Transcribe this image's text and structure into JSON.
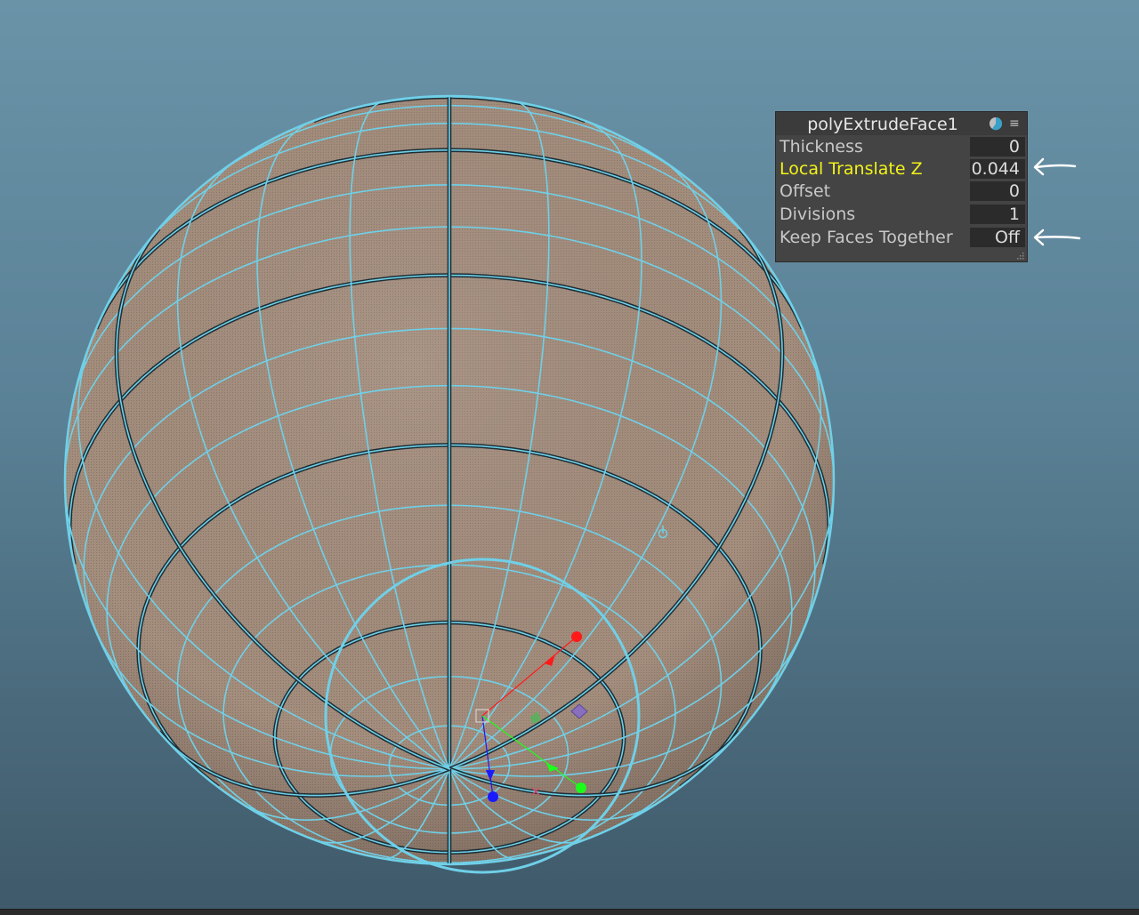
{
  "channel_box": {
    "title": "polyExtrudeFace1",
    "attributes": [
      {
        "label": "Thickness",
        "value": "0"
      },
      {
        "label": "Local Translate Z",
        "value": "0.044"
      },
      {
        "label": "Offset",
        "value": "0"
      },
      {
        "label": "Divisions",
        "value": "1"
      },
      {
        "label": "Keep Faces Together",
        "value": "Off"
      }
    ],
    "highlighted_attribute": "Local Translate Z",
    "highlight_color": "#f2f21a"
  },
  "icons": {
    "panel_icon": "pie-chart-icon",
    "panel_menu": "hamburger-menu-icon",
    "resize": "resize-grip-icon",
    "annotation": "arrow-left-icon",
    "pivot": "pivot-icon"
  },
  "colors": {
    "wireframe": "#6fd0e8",
    "surface": "#a08a7a",
    "background_top": "#6a93a8",
    "background_bottom": "#3f5a6a",
    "gizmo_x": "#ff1a1a",
    "gizmo_y": "#1aff1a",
    "gizmo_z": "#1a1aff"
  }
}
